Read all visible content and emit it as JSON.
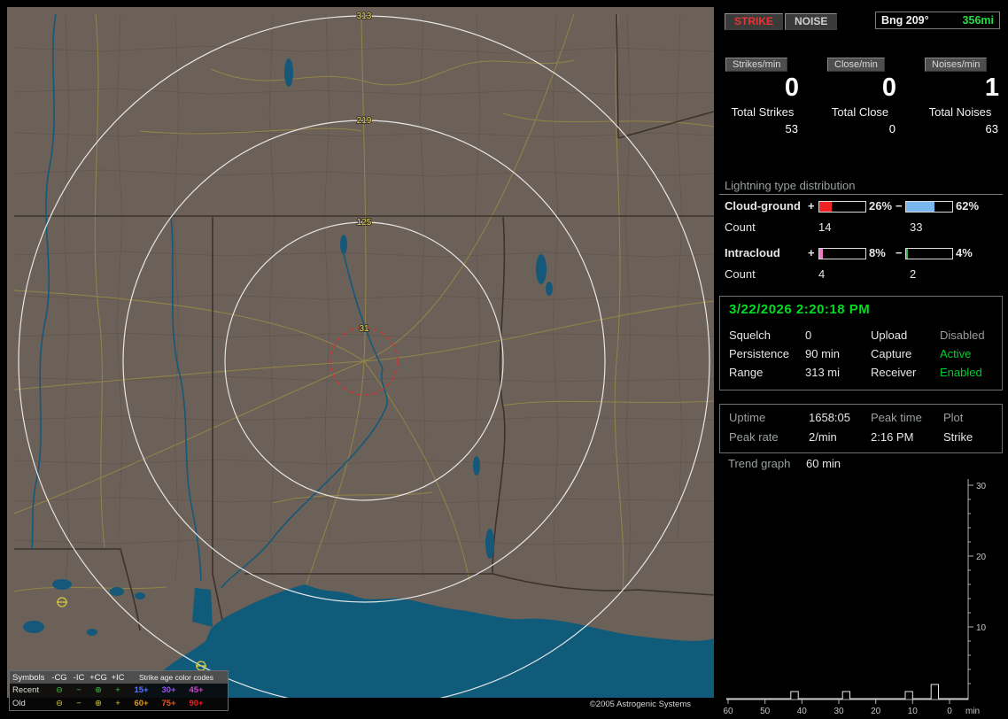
{
  "map": {
    "rings": {
      "r31": "31",
      "r125": "125",
      "r219": "219",
      "r313": "313"
    },
    "copyright": "©2005 Astrogenic Systems",
    "legend": {
      "symbols_header": "Symbols",
      "cols": [
        "-CG",
        "-IC",
        "+CG",
        "+IC"
      ],
      "age_header": "Strike age color codes",
      "recent_label": "Recent",
      "old_label": "Old",
      "glyphs": [
        "⊖",
        "−",
        "⊕",
        "+"
      ],
      "recent_ages": [
        "15+",
        "30+",
        "45+"
      ],
      "old_ages": [
        "60+",
        "75+",
        "90+"
      ],
      "recent_symbol_color": "#3fbf3f",
      "old_symbol_color": "#d8c938",
      "recent_age_colors": [
        "#5577ff",
        "#9955ee",
        "#cc44cc"
      ],
      "old_age_colors": [
        "#dd9922",
        "#ee5522",
        "#ee2222"
      ]
    }
  },
  "panel": {
    "strike_button": {
      "label": "STRIKE",
      "color": "#e83434"
    },
    "noise_button": {
      "label": "NOISE",
      "color": "#cfcfcf"
    },
    "bearing": {
      "label": "Bng 209°",
      "range": "356mi",
      "range_color": "#22dd44"
    },
    "columns": [
      {
        "header": "Strikes/min",
        "rate": "0",
        "total_label": "Total Strikes",
        "total": "53"
      },
      {
        "header": "Close/min",
        "rate": "0",
        "total_label": "Total Close",
        "total": "0"
      },
      {
        "header": "Noises/min",
        "rate": "1",
        "total_label": "Total Noises",
        "total": "63"
      }
    ],
    "distribution": {
      "title": "Lightning type distribution",
      "rows": [
        {
          "label": "Cloud-ground",
          "plus_sign": "+",
          "minus_sign": "−",
          "plus_pct": "26%",
          "plus_width": 26,
          "plus_color": "#ee2222",
          "minus_pct": "62%",
          "minus_width": 62,
          "minus_color": "#77b7ee",
          "count_label": "Count",
          "plus_count": "14",
          "minus_count": "33"
        },
        {
          "label": "Intracloud",
          "plus_sign": "+",
          "minus_sign": "−",
          "plus_pct": "8%",
          "plus_width": 8,
          "plus_color": "#ee77cc",
          "minus_pct": "4%",
          "minus_width": 4,
          "minus_color": "#33bb44",
          "count_label": "Count",
          "plus_count": "4",
          "minus_count": "2"
        }
      ]
    },
    "datetime": {
      "text": "3/22/2026 2:20:18 PM",
      "color": "#00dd22"
    },
    "settings": [
      {
        "label": "Squelch",
        "value": "0",
        "label2": "Upload",
        "value2": "Disabled",
        "value2_color": "#9a9a9a"
      },
      {
        "label": "Persistence",
        "value": "90 min",
        "label2": "Capture",
        "value2": "Active",
        "value2_color": "#00cc33"
      },
      {
        "label": "Range",
        "value": "313 mi",
        "label2": "Receiver",
        "value2": "Enabled",
        "value2_color": "#00cc33"
      }
    ],
    "stats": {
      "uptime_label": "Uptime",
      "uptime_value": "1658:05",
      "peak_time_label": "Peak time",
      "peak_time_value": "2:16 PM",
      "plot_label": "Plot",
      "plot_value": "Strike",
      "peak_rate_label": "Peak rate",
      "peak_rate_value": "2/min"
    },
    "trend": {
      "label": "Trend graph",
      "window": "60 min",
      "y_ticks": [
        "30",
        "20",
        "10"
      ],
      "x_ticks": [
        "60",
        "50",
        "40",
        "30",
        "20",
        "10",
        "0"
      ],
      "x_unit": "min",
      "pulses": [
        {
          "min": 42,
          "rate": 1
        },
        {
          "min": 28,
          "rate": 1
        },
        {
          "min": 11,
          "rate": 1
        },
        {
          "min": 4,
          "rate": 2
        }
      ]
    }
  }
}
